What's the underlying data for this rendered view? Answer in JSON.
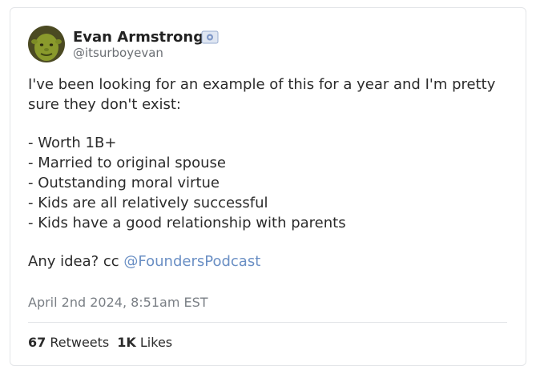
{
  "author": {
    "display_name": "Evan Armstrong",
    "handle": "@itsurboyevan",
    "avatar_icon": "ogre-avatar",
    "badge_icon": "verified-badge-icon"
  },
  "tweet": {
    "line1": "I've been looking for an example of this for a year and I'm pretty sure they don't exist:",
    "list": [
      "- Worth 1B+",
      "- Married to original spouse",
      "- Outstanding moral virtue",
      "- Kids are all relatively successful",
      "- Kids have a good relationship with parents"
    ],
    "closing_prefix": "Any idea? cc ",
    "mention": "@FoundersPodcast",
    "timestamp": "April 2nd 2024, 8:51am EST"
  },
  "stats": {
    "retweets_count": "67",
    "retweets_label": "Retweets",
    "likes_count": "1K",
    "likes_label": "Likes"
  },
  "colors": {
    "mention": "#6a8fc4",
    "border": "#e3e5e8",
    "muted": "#7a7f85"
  }
}
